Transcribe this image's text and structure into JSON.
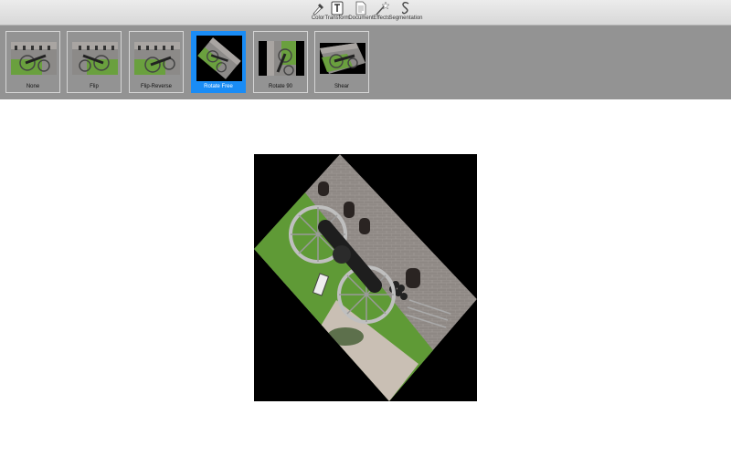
{
  "toolbar": {
    "items": [
      {
        "label": "Color",
        "icon": "eyedropper-icon",
        "active": false
      },
      {
        "label": "Transform",
        "icon": "transform-icon",
        "active": true
      },
      {
        "label": "Document",
        "icon": "document-icon",
        "active": false
      },
      {
        "label": "Effects",
        "icon": "magic-wand-icon",
        "active": false
      },
      {
        "label": "Segmentation",
        "icon": "lasso-icon",
        "active": false
      }
    ]
  },
  "filters": {
    "items": [
      {
        "label": "None",
        "selected": false
      },
      {
        "label": "Flip",
        "selected": false
      },
      {
        "label": "Flip-Reverse",
        "selected": false
      },
      {
        "label": "Rotate Free",
        "selected": true
      },
      {
        "label": "Rotate 90",
        "selected": false
      },
      {
        "label": "Shear",
        "selected": false
      }
    ]
  },
  "colors": {
    "toolbar_bg": "#dcdcdc",
    "strip_bg": "#939393",
    "selection": "#1a8cf5",
    "canvas_bg": "#000000"
  }
}
